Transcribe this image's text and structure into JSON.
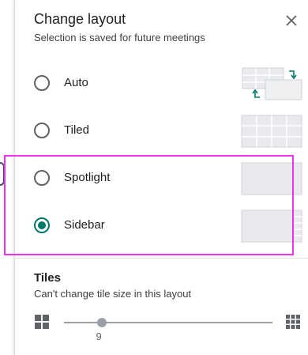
{
  "dialog": {
    "title": "Change layout",
    "subtitle": "Selection is saved for future meetings"
  },
  "options": [
    {
      "label": "Auto",
      "selected": false,
      "icon": "auto-layout-icon"
    },
    {
      "label": "Tiled",
      "selected": false,
      "icon": "tiled-layout-icon"
    },
    {
      "label": "Spotlight",
      "selected": false,
      "icon": "spotlight-layout-icon"
    },
    {
      "label": "Sidebar",
      "selected": true,
      "icon": "sidebar-layout-icon"
    }
  ],
  "tiles": {
    "title": "Tiles",
    "subtitle": "Can't change tile size in this layout",
    "slider_value": "9",
    "slider_fraction": 0.18,
    "min_icon": "grid-small-icon",
    "max_icon": "grid-large-icon"
  },
  "colors": {
    "accent": "#00796b",
    "highlight": "#ee33ee"
  }
}
